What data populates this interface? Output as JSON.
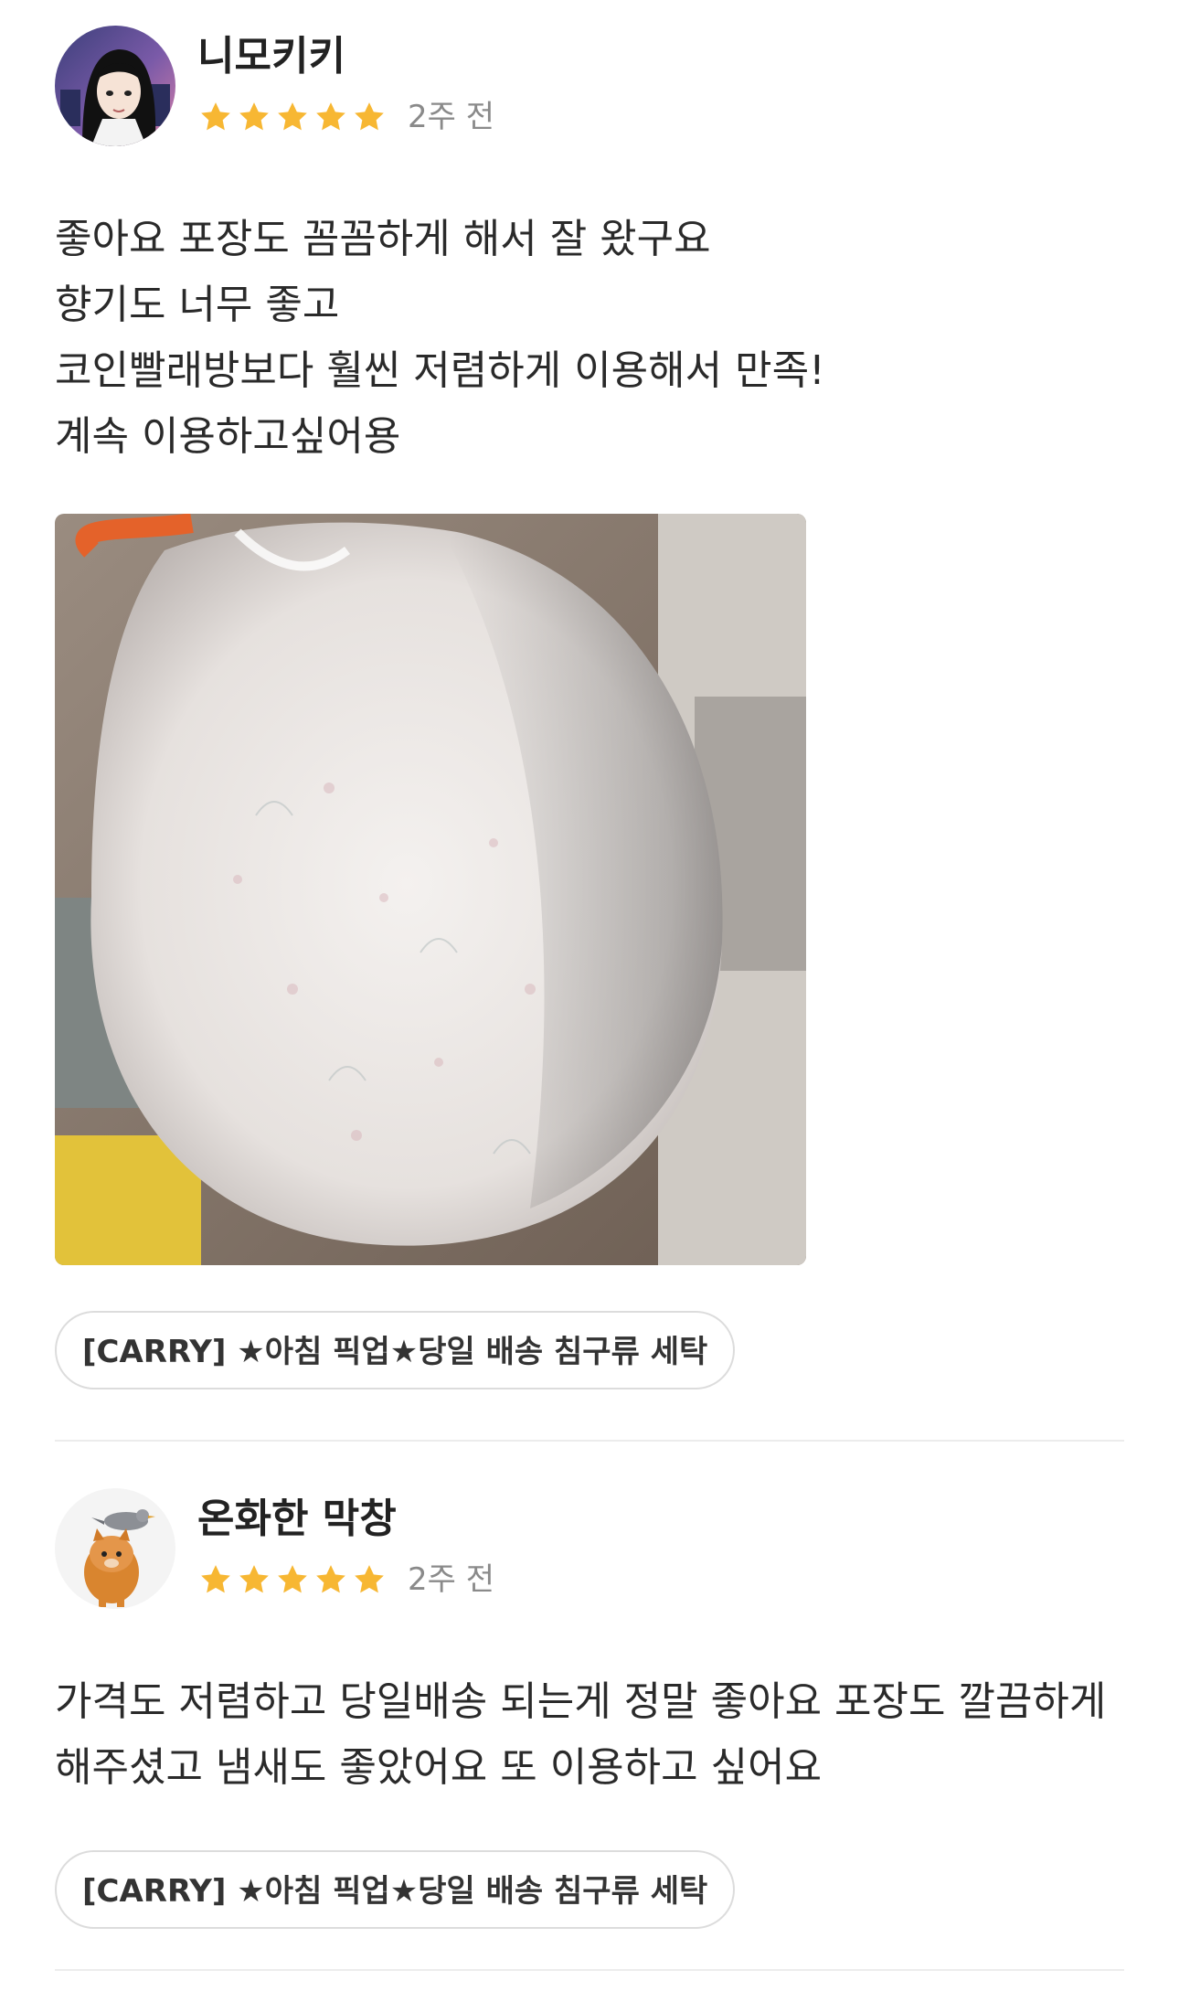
{
  "reviews": [
    {
      "author": "니모키키",
      "rating": 5,
      "rating_max": 5,
      "date": "2주 전",
      "lines": [
        "좋아요 포장도 꼼꼼하게 해서 잘 왔구요",
        "향기도 너무 좋고",
        "코인빨래방보다 훨씬 저렴하게 이용해서 만족!",
        "계속 이용하고싶어용"
      ],
      "has_photo": true,
      "product_tag": "[CARRY] ★아침 픽업★당일 배송 침구류 세탁"
    },
    {
      "author": "온화한 막창",
      "rating": 5,
      "rating_max": 5,
      "date": "2주 전",
      "lines": [
        "가격도 저렴하고 당일배송 되는게 정말 좋아요 포장도 깔끔하게",
        "해주셨고 냄새도 좋았어요 또 이용하고 싶어요"
      ],
      "has_photo": false,
      "product_tag": "[CARRY] ★아침 픽업★당일 배송 침구류 세탁"
    }
  ],
  "colors": {
    "star": "#F7B733",
    "date": "#8a8a8a",
    "text": "#2a2a2a",
    "divider": "#ececec",
    "tag_border": "#dcdcdc"
  },
  "icons": {
    "star": "star-icon"
  }
}
